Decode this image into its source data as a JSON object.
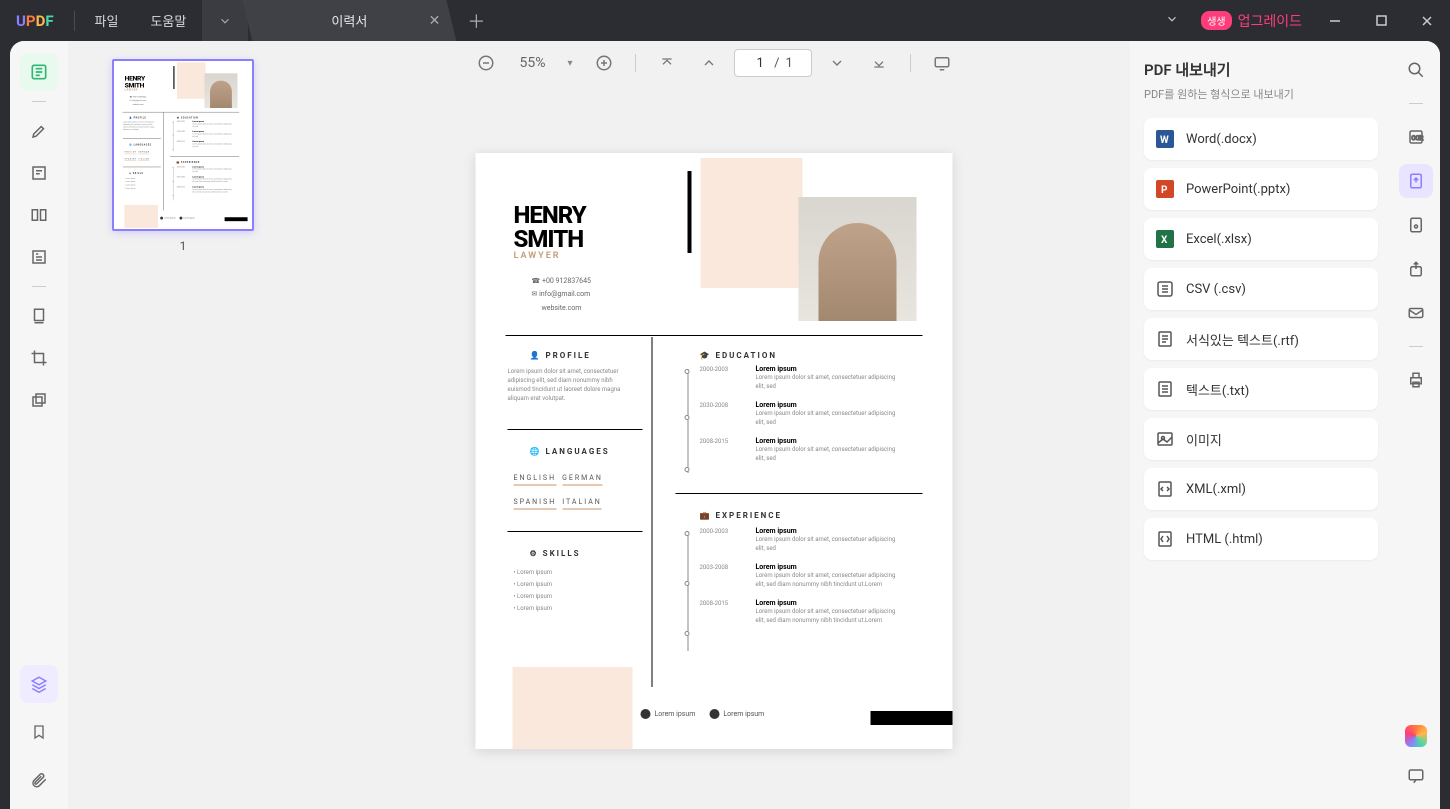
{
  "titlebar": {
    "logo": "UPDF",
    "menu_file": "파일",
    "menu_help": "도움말",
    "tab_title": "이력서",
    "upgrade_badge": "생생",
    "upgrade_text": "업그레이드"
  },
  "toolbar": {
    "zoom": "55%",
    "page_current": "1",
    "page_total": "1"
  },
  "thumbnails": {
    "page1_num": "1"
  },
  "export": {
    "title": "PDF 내보내기",
    "subtitle": "PDF를 원하는 형식으로 내보내기",
    "formats": [
      {
        "icon": "word",
        "label": "Word(.docx)"
      },
      {
        "icon": "ppt",
        "label": "PowerPoint(.pptx)"
      },
      {
        "icon": "excel",
        "label": "Excel(.xlsx)"
      },
      {
        "icon": "csv",
        "label": "CSV (.csv)"
      },
      {
        "icon": "rtf",
        "label": "서식있는 텍스트(.rtf)"
      },
      {
        "icon": "txt",
        "label": "텍스트(.txt)"
      },
      {
        "icon": "image",
        "label": "이미지"
      },
      {
        "icon": "xml",
        "label": "XML(.xml)"
      },
      {
        "icon": "html",
        "label": "HTML (.html)"
      }
    ]
  },
  "resume": {
    "name1": "HENRY",
    "name2": "SMITH",
    "role": "LAWYER",
    "phone": "+00 912837645",
    "email": "info@gmail.com",
    "website": "website.com",
    "sect_profile": "PROFILE",
    "profile_body": "Lorem ipsum dolor sit amet, consectetuer adipiscing elit, sed diam nonummy nibh euismod tincidunt ut laoreet dolore magna aliquam erat volutpat.",
    "sect_lang": "LANGUAGES",
    "lang1": "ENGLISH",
    "lang2": "GERMAN",
    "lang3": "SPANISH",
    "lang4": "ITALIAN",
    "sect_skills": "SKILLS",
    "skill": "Lorem ipsum",
    "sect_edu": "EDUCATION",
    "sect_exp": "EXPERIENCE",
    "yr1": "2000-2003",
    "yr2": "2030-2008",
    "yr3": "2008-2015",
    "yrx1": "2000-2003",
    "yrx2": "2003-2008",
    "yrx3": "2008-2015",
    "item_title": "Lorem ipsum",
    "item_body": "Lorem ipsum dolor sit amet, consectetuer adipiscing elit, sed",
    "item_body_long": "Lorem ipsum dolor sit amet, consectetuer adipiscing elit, sed diam nonummy nibh tincidunt ut.Lorem",
    "social": "Lorem ipsum"
  }
}
